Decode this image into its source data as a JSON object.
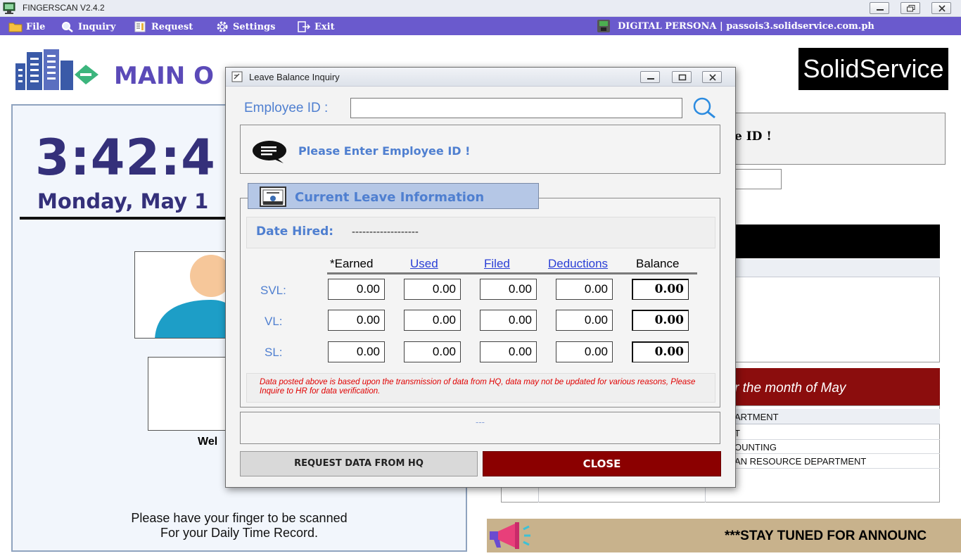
{
  "window": {
    "title": "FINGERSCAN V2.4.2",
    "icon": "fingerprint-scanner-icon"
  },
  "menu": {
    "items": [
      {
        "label": "File",
        "icon": "folder-icon"
      },
      {
        "label": "Inquiry",
        "icon": "magnifier-icon"
      },
      {
        "label": "Request",
        "icon": "form-icon"
      },
      {
        "label": "Settings",
        "icon": "gear-icon"
      },
      {
        "label": "Exit",
        "icon": "exit-icon"
      }
    ],
    "device": "DIGITAL PERSONA | passois3.solidservice.com.ph",
    "device_icon": "scanner-device-icon"
  },
  "header": {
    "title": "MAIN O",
    "brand": "SolidService"
  },
  "left_panel": {
    "time": "3:42:4",
    "date": "Monday, May 1",
    "welcome": "Wel",
    "finger_note_line1": "Please have your finger to be scanned",
    "finger_note_line2": "For your Daily Time Record."
  },
  "right_panel": {
    "prompt": "e ID !",
    "month_banner": "r the month of May",
    "dept_header": "ARTMENT",
    "dept_rows": [
      "T",
      "OUNTING",
      "AN RESOURCE DEPARTMENT"
    ],
    "announcement": "***STAY TUNED FOR ANNOUNC"
  },
  "dialog": {
    "title": "Leave Balance Inquiry",
    "employee_id_label": "Employee ID :",
    "employee_id_value": "",
    "message": "Please Enter Employee ID !",
    "section_title": "Current Leave Information",
    "date_hired_label": "Date Hired:",
    "date_hired_value": "-------------------",
    "columns": [
      "*Earned",
      "Used",
      "Filed",
      "Deductions",
      "Balance"
    ],
    "rows": [
      {
        "label": "SVL:",
        "earned": "0.00",
        "used": "0.00",
        "filed": "0.00",
        "deductions": "0.00",
        "balance": "0.00"
      },
      {
        "label": "VL:",
        "earned": "0.00",
        "used": "0.00",
        "filed": "0.00",
        "deductions": "0.00",
        "balance": "0.00"
      },
      {
        "label": "SL:",
        "earned": "0.00",
        "used": "0.00",
        "filed": "0.00",
        "deductions": "0.00",
        "balance": "0.00"
      }
    ],
    "disclaimer": "Data posted above is based upon the transmission of data from HQ, data may not be updated for various reasons, Please Inquire to HR for data verification.",
    "status": "---",
    "request_button": "REQUEST DATA FROM HQ",
    "close_button": "CLOSE"
  },
  "colors": {
    "menubar": "#6a5acd",
    "accent_text": "#4f7fd0",
    "close_button": "#8b0000",
    "month_banner": "#8b0d0d",
    "announcement_bar": "#c8b28c",
    "link": "#2a3fd6",
    "disclaimer": "#e00000"
  }
}
